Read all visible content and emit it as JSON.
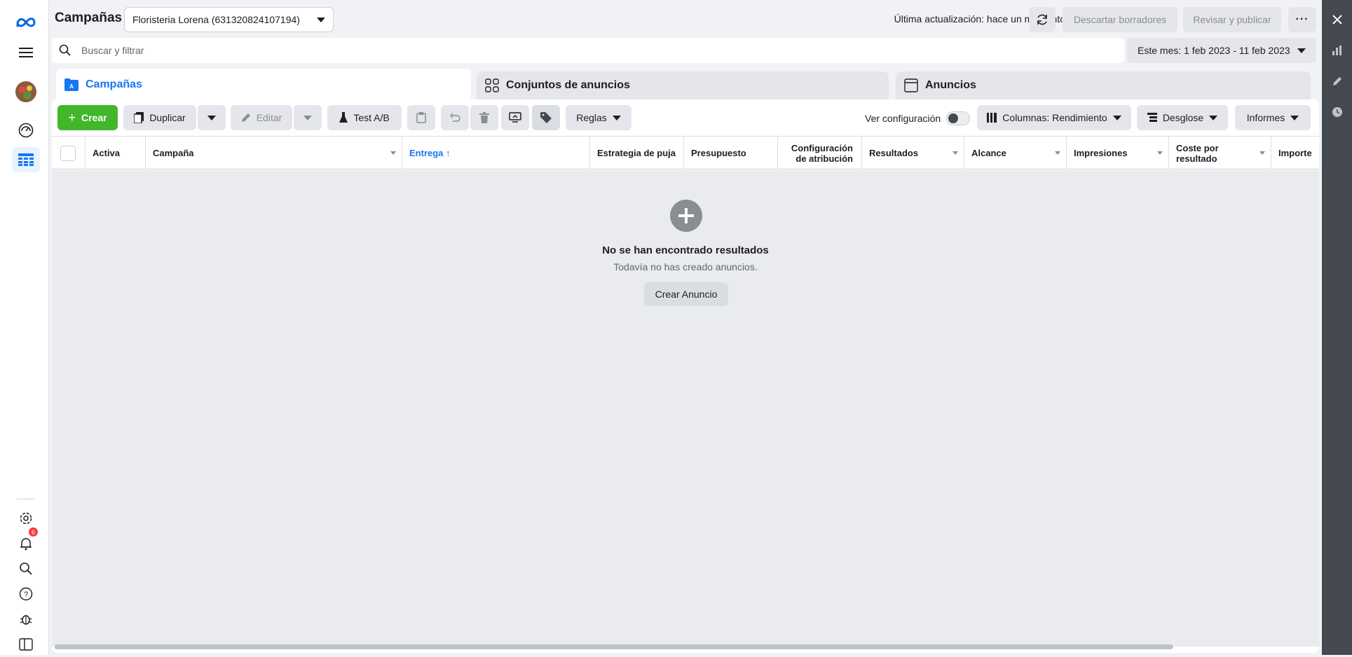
{
  "header": {
    "title": "Campañas",
    "account": "Floristeria Lorena (631320824107194)",
    "updated": "Última actualización: hace un momento",
    "discard": "Descartar borradores",
    "review": "Revisar y publicar"
  },
  "search": {
    "placeholder": "Buscar y filtrar",
    "date_range": "Este mes: 1 feb 2023 - 11 feb 2023"
  },
  "tabs": [
    {
      "label": "Campañas"
    },
    {
      "label": "Conjuntos de anuncios"
    },
    {
      "label": "Anuncios"
    }
  ],
  "toolbar": {
    "create": "Crear",
    "duplicate": "Duplicar",
    "edit": "Editar",
    "ab_test": "Test A/B",
    "rules": "Reglas",
    "view_config": "Ver configuración",
    "columns": "Columnas: Rendimiento",
    "breakdown": "Desglose",
    "reports": "Informes"
  },
  "table": {
    "columns": [
      "Activa",
      "Campaña",
      "Entrega ↑",
      "Estrategia de puja",
      "Presupuesto",
      "Configuración de atribución",
      "Resultados",
      "Alcance",
      "Impresiones",
      "Coste por resultado",
      "Importe"
    ]
  },
  "empty": {
    "title": "No se han encontrado resultados",
    "subtitle": "Todavía no has creado anuncios.",
    "button": "Crear Anuncio"
  },
  "nav": {
    "notifications_count": "6"
  },
  "colors": {
    "accent": "#1876f2",
    "create": "#42b72a",
    "rightbar": "#444950"
  }
}
